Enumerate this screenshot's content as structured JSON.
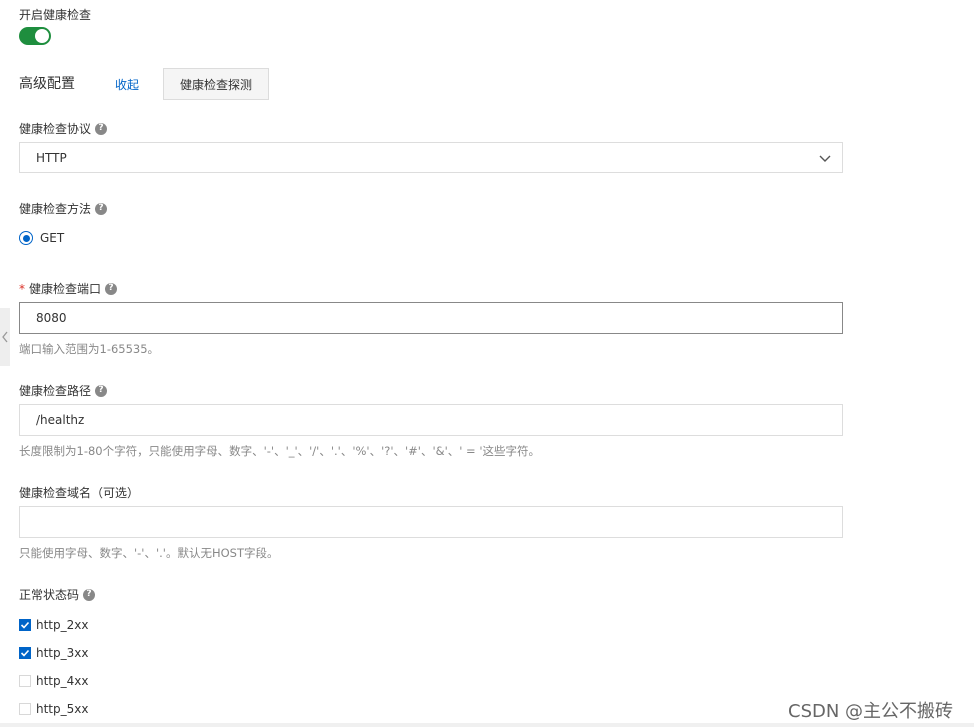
{
  "health_check": {
    "enable_label": "开启健康检查",
    "enabled": true
  },
  "advanced": {
    "title": "高级配置",
    "collapse_link": "收起",
    "probe_button": "健康检查探测"
  },
  "protocol": {
    "label": "健康检查协议",
    "help": "?",
    "value": "HTTP"
  },
  "method": {
    "label": "健康检查方法",
    "help": "?",
    "option": "GET",
    "selected": true
  },
  "port": {
    "required": "*",
    "label": "健康检查端口",
    "help": "?",
    "value": "8080",
    "hint": "端口输入范围为1-65535。"
  },
  "path": {
    "label": "健康检查路径",
    "help": "?",
    "value": "/healthz",
    "hint": "长度限制为1-80个字符，只能使用字母、数字、'-'、'_'、'/'、'.'、'%'、'?'、'#'、'&'、' = '这些字符。"
  },
  "domain": {
    "label": "健康检查域名（可选）",
    "value": "",
    "hint": "只能使用字母、数字、'-'、'.'。默认无HOST字段。"
  },
  "status_codes": {
    "label": "正常状态码",
    "help": "?",
    "options": [
      {
        "label": "http_2xx",
        "checked": true
      },
      {
        "label": "http_3xx",
        "checked": true
      },
      {
        "label": "http_4xx",
        "checked": false
      },
      {
        "label": "http_5xx",
        "checked": false
      }
    ]
  },
  "watermark": "CSDN @主公不搬砖",
  "colors": {
    "primary": "#0064c8",
    "toggle_on": "#1e8e3e",
    "required": "#d93026"
  }
}
